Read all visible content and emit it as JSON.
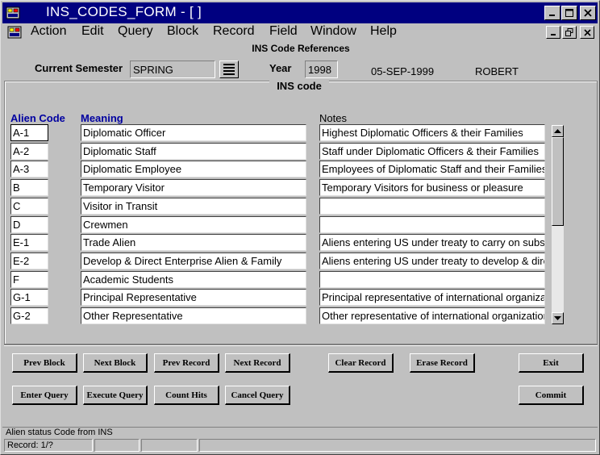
{
  "window": {
    "title": "INS_CODES_FORM - [ ]",
    "title_bar_color": "#000080"
  },
  "menu": [
    "Action",
    "Edit",
    "Query",
    "Block",
    "Record",
    "Field",
    "Window",
    "Help"
  ],
  "form": {
    "header_title": "INS Code References",
    "current_semester_label": "Current Semester",
    "current_semester_value": "SPRING",
    "year_label": "Year",
    "year_value": "1998",
    "date": "05-SEP-1999",
    "user": "ROBERT"
  },
  "block": {
    "title": "INS code",
    "columns": {
      "alien_code": "Alien Code",
      "meaning": "Meaning",
      "notes": "Notes"
    },
    "rows": [
      {
        "code": "A-1",
        "meaning": "Diplomatic Officer",
        "notes": "Highest Diplomatic Officers & their Families"
      },
      {
        "code": "A-2",
        "meaning": "Diplomatic Staff",
        "notes": "Staff under Diplomatic Officers & their Families"
      },
      {
        "code": "A-3",
        "meaning": "Diplomatic Employee",
        "notes": "Employees of Diplomatic Staff and their Families"
      },
      {
        "code": "B",
        "meaning": "Temporary Visitor",
        "notes": "Temporary Visitors for business or pleasure"
      },
      {
        "code": "C",
        "meaning": "Visitor in Transit",
        "notes": ""
      },
      {
        "code": "D",
        "meaning": "Crewmen",
        "notes": ""
      },
      {
        "code": "E-1",
        "meaning": "Trade Alien",
        "notes": "Aliens entering US under treaty to carry on substantial trade"
      },
      {
        "code": "E-2",
        "meaning": "Develop & Direct Enterprise Alien & Family",
        "notes": "Aliens entering US under treaty to develop & direct enterprise"
      },
      {
        "code": "F",
        "meaning": "Academic Students",
        "notes": ""
      },
      {
        "code": "G-1",
        "meaning": "Principal Representative",
        "notes": "Principal representative of international organization"
      },
      {
        "code": "G-2",
        "meaning": "Other Representative",
        "notes": "Other representative of international organization"
      }
    ]
  },
  "buttons": {
    "prev_block": "Prev Block",
    "next_block": "Next Block",
    "prev_record": "Prev Record",
    "next_record": "Next Record",
    "clear_record": "Clear Record",
    "erase_record": "Erase Record",
    "exit": "Exit",
    "enter_query": "Enter Query",
    "execute_query": "Execute Query",
    "count_hits": "Count Hits",
    "cancel_query": "Cancel Query",
    "commit": "Commit"
  },
  "status": {
    "hint": "Alien status Code from INS",
    "record": "Record: 1/?"
  },
  "icons": {
    "app": "oracle-forms-icon",
    "lov": "list-of-values-icon"
  }
}
